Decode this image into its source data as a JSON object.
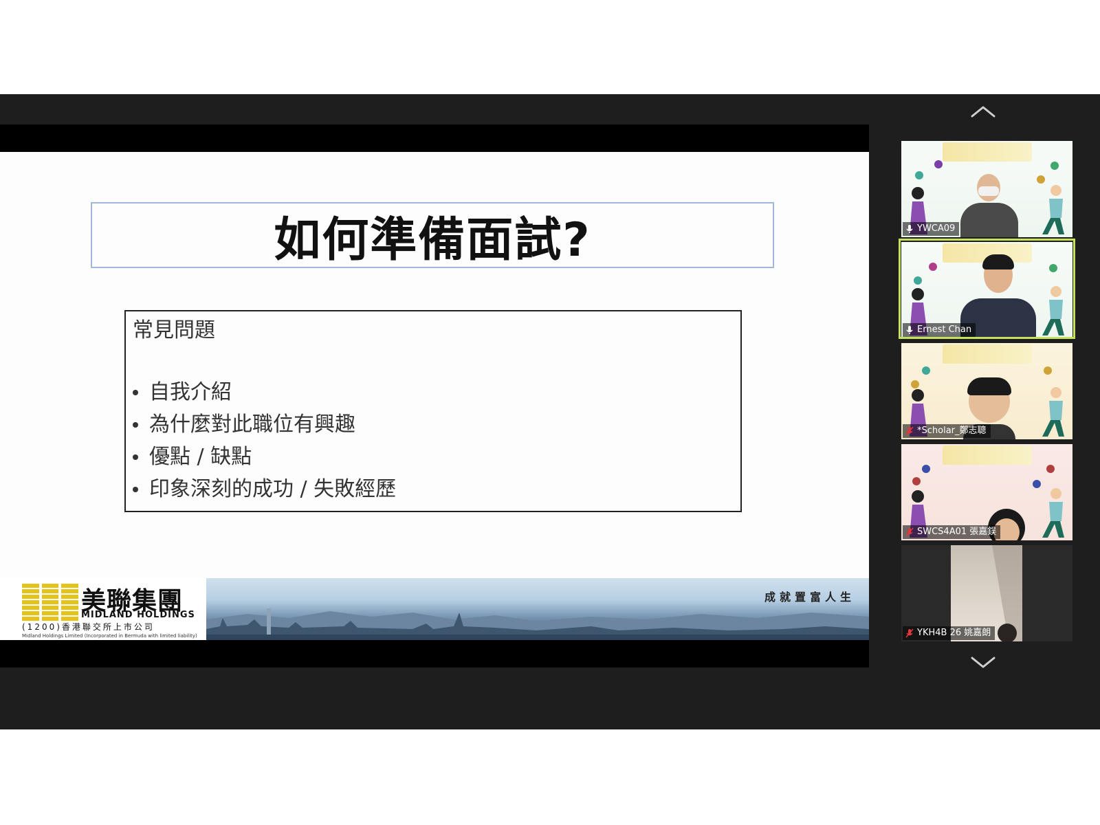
{
  "slide": {
    "title": "如何準備面試?",
    "content_heading": "常見問題",
    "bullets": [
      "自我介紹",
      "為什麼對此職位有興趣",
      "優點 / 缺點",
      "印象深刻的成功 / 失敗經歷"
    ],
    "logo": {
      "name_cn": "美聯集團",
      "name_en": "MIDLAND HOLDINGS",
      "listing": "(1200)香港聯交所上市公司",
      "legal": "Midland Holdings Limited (Incorporated in Bermuda with limited liability)"
    },
    "slogan": "成就置富人生"
  },
  "participants": [
    {
      "name": "YWCA09",
      "audio": "unmuted",
      "active": false
    },
    {
      "name": "Ernest Chan",
      "audio": "unmuted",
      "active": true
    },
    {
      "name": "*Scholar_鄭志聰",
      "audio": "muted",
      "active": false
    },
    {
      "name": "SWCS4A01 張嘉鋘",
      "audio": "muted",
      "active": false
    },
    {
      "name": "YKH4B 26 姚嘉朗",
      "audio": "muted",
      "active": false
    }
  ],
  "icons": {
    "scroll_up": "chevron-up-icon",
    "scroll_down": "chevron-down-icon",
    "mic": "microphone-icon",
    "mic_muted": "microphone-muted-icon"
  },
  "colors": {
    "meeting_bg": "#1e1e1e",
    "active_speaker": "#c5e25a",
    "muted_icon": "#e0383e",
    "logo_gold": "#e7c21a"
  }
}
